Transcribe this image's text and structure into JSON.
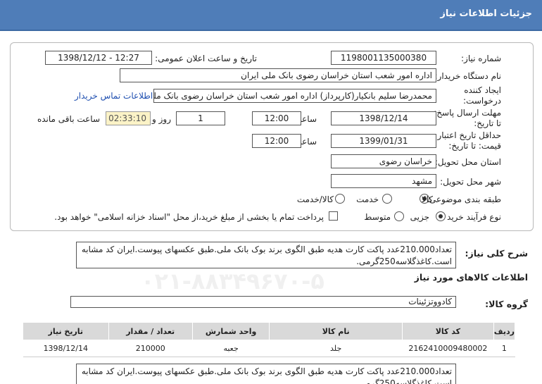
{
  "header": {
    "title": "جزئیات اطلاعات نیاز"
  },
  "form": {
    "need_number_label": "شماره نیاز:",
    "need_number": "1198001135000380",
    "announce_label": "تاریخ و ساعت اعلان عمومی:",
    "announce_value": "1398/12/12 - 12:27",
    "buyer_label": "نام دستگاه خریدار:",
    "buyer_value": "اداره امور شعب استان خراسان رضوی بانک ملی ایران",
    "creator_label": "ایجاد کننده درخواست:",
    "creator_value": "محمدرضا سلیم  بانکیار(کارپرداز) اداره امور شعب استان خراسان رضوی بانک ملی ایران",
    "contact_link": "اطلاعات تماس خریدار",
    "deadline_label": "مهلت ارسال پاسخ: تا تاریخ:",
    "deadline_date": "1398/12/14",
    "time_label": "ساعت",
    "deadline_time": "12:00",
    "days_value": "1",
    "days_label": "روز و",
    "timer_value": "02:33:10",
    "remaining_label": "ساعت باقی مانده",
    "validity_label": "حداقل تاریخ اعتبار قیمت: تا تاریخ:",
    "validity_date": "1399/01/31",
    "validity_time": "12:00",
    "province_label": "استان محل تحویل:",
    "province_value": "خراسان رضوی",
    "city_label": "شهر محل تحویل:",
    "city_value": "مشهد",
    "category_label": "طبقه بندی موضوعی:",
    "category_options": [
      "کالا",
      "خدمت",
      "کالا/خدمت"
    ],
    "process_label": "نوع فرآیند خرید :",
    "process_options": [
      "جزیی",
      "متوسط"
    ],
    "payment_note": "پرداخت تمام یا بخشی از مبلغ خرید،از محل \"اسناد خزانه اسلامی\" خواهد بود."
  },
  "summary": {
    "label": "شرح کلی نیاز:",
    "text": "تعداد210.000عدد پاکت کارت هدیه طبق الگوی برند بوک بانک ملی.طبق  عکسهای پیوست.ایران کد مشابه است.کاغذگلاسه250گرمی."
  },
  "goods_info_title": "اطلاعات کالاهای مورد نیاز",
  "goods_group": {
    "label": "گروه کالا:",
    "value": "کادووتزئینات"
  },
  "table": {
    "headers": [
      "ردیف",
      "کد کالا",
      "نام کالا",
      "واحد شمارش",
      "تعداد / مقدار",
      "تاریخ نیاز"
    ],
    "rows": [
      [
        "1",
        "2162410009480002",
        "جلد",
        "جعبه",
        "210000",
        "1398/12/14"
      ]
    ]
  },
  "bottom_note": "تعداد210.000عدد پاکت کارت هدیه طبق الگوی برند بوک بانک ملی.طبق  عکسهای پیوست.ایران کد مشابه است.کاغذگلاسه250گرمی.",
  "watermark": "۰۲۱-۸۸۳۴۹۶۷۰-۵"
}
